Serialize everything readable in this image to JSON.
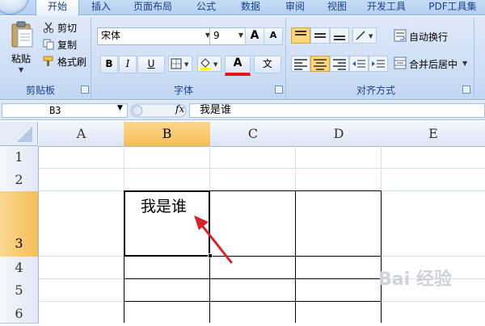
{
  "ribbon": {
    "tabs": [
      {
        "label": "开始",
        "active": true
      },
      {
        "label": "插入"
      },
      {
        "label": "页面布局"
      },
      {
        "label": "公式"
      },
      {
        "label": "数据"
      },
      {
        "label": "审阅"
      },
      {
        "label": "视图"
      },
      {
        "label": "开发工具"
      },
      {
        "label": "PDF工具集"
      }
    ],
    "clipboard": {
      "paste_label": "粘贴",
      "cut_label": "剪切",
      "copy_label": "复制",
      "format_painter_label": "格式刷",
      "group_label": "剪贴板"
    },
    "font": {
      "font_name": "宋体",
      "font_size": "9",
      "grow_label": "A",
      "shrink_label": "A",
      "bold_label": "B",
      "italic_label": "I",
      "underline_label": "U",
      "font_color_label": "A",
      "phonetic_label": "文",
      "group_label": "字体"
    },
    "alignment": {
      "wrap_text_label": "自动换行",
      "merge_center_label": "合并后居中",
      "group_label": "对齐方式"
    }
  },
  "formula_bar": {
    "name_box": "B3",
    "fx_label": "fx",
    "content": "我是谁"
  },
  "sheet": {
    "columns": [
      "A",
      "B",
      "C",
      "D",
      "E"
    ],
    "rows": [
      "1",
      "2",
      "3",
      "4",
      "5",
      "6"
    ],
    "selected_cell": "B3",
    "selected_column": "B",
    "selected_row": "3",
    "cell_b3": "我是谁"
  },
  "watermark": "Bai 经验",
  "colors": {
    "selection_header": "#f7bd55",
    "ribbon_blue": "#c9dbf3",
    "arrow_red": "#d9232a"
  },
  "icons": [
    "office-orb-icon",
    "paste-icon",
    "cut-icon",
    "copy-icon",
    "format-painter-icon",
    "borders-icon",
    "fill-color-icon",
    "align-top-icon",
    "align-middle-icon",
    "align-bottom-icon",
    "orientation-icon",
    "align-left-icon",
    "align-center-icon",
    "align-right-icon",
    "decrease-indent-icon",
    "increase-indent-icon",
    "wrap-text-icon",
    "merge-center-icon",
    "dialog-launcher-icon",
    "select-all-icon",
    "red-arrow-annotation"
  ]
}
